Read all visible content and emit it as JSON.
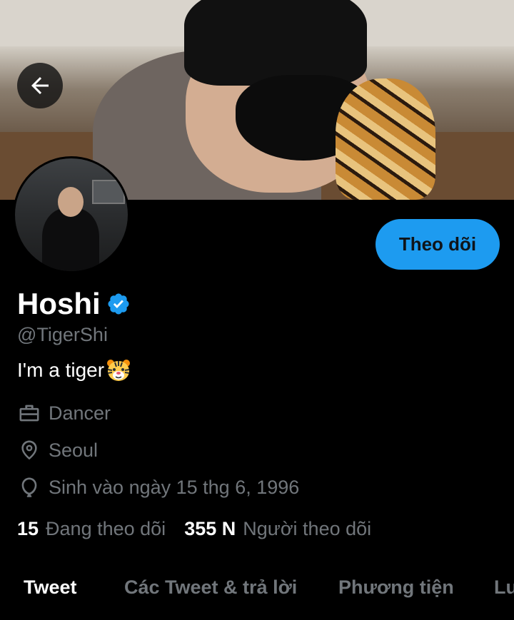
{
  "header": {
    "back_icon": "arrow-left-icon"
  },
  "profile": {
    "name": "Hoshi",
    "verified_icon": "verified-badge-icon",
    "handle": "@TigerShi",
    "bio_text": "I'm a tiger",
    "bio_emoji": "tiger-face-emoji",
    "follow_button": "Theo dõi",
    "occupation": "Dancer",
    "location": "Seoul",
    "birthday": "Sinh vào ngày 15 thg 6, 1996",
    "following_count": "15",
    "following_label": "Đang theo dõi",
    "followers_count": "355 N",
    "followers_label": "Người theo dõi"
  },
  "tabs": [
    {
      "label": "Tweet",
      "active": true
    },
    {
      "label": "Các Tweet & trả lời",
      "active": false
    },
    {
      "label": "Phương tiện",
      "active": false
    },
    {
      "label": "Lư",
      "active": false
    }
  ],
  "colors": {
    "accent": "#1d9bf0",
    "background": "#000000",
    "secondary_text": "#71767b",
    "primary_text": "#ffffff"
  }
}
